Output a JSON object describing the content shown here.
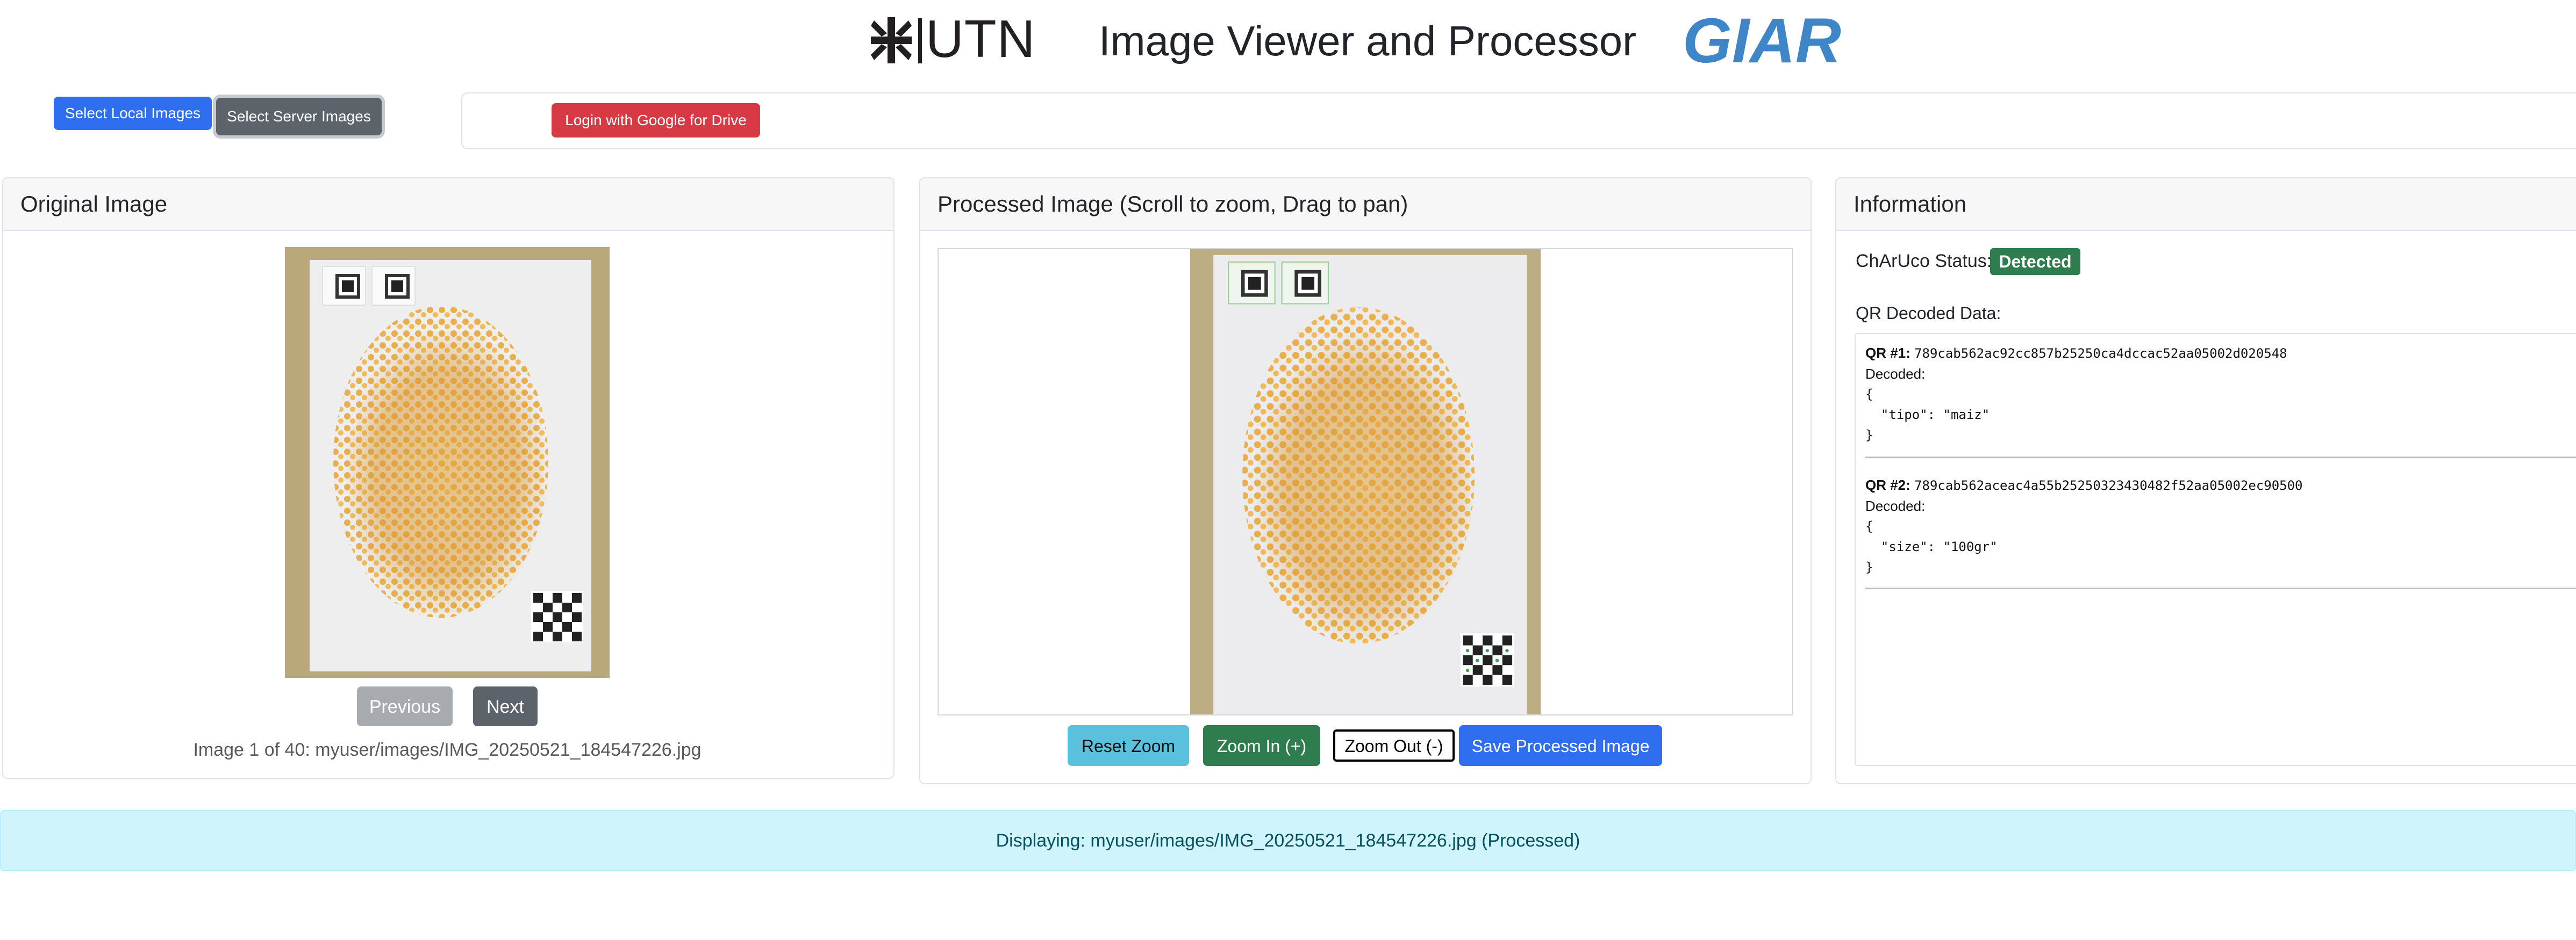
{
  "header": {
    "utn_logo_text": "UTN",
    "title": "Image Viewer and Processor",
    "giar_logo_text": "GIAR"
  },
  "toolbar": {
    "select_local_label": "Select Local Images",
    "select_server_label": "Select Server Images",
    "drive_login_label": "Login with Google for Drive"
  },
  "original_card": {
    "title": "Original Image",
    "previous_label": "Previous",
    "next_label": "Next",
    "counter_text": "Image 1 of 40: myuser/images/IMG_20250521_184547226.jpg"
  },
  "processed_card": {
    "title": "Processed Image (Scroll to zoom, Drag to pan)",
    "reset_zoom_label": "Reset Zoom",
    "zoom_in_label": "Zoom In (+)",
    "zoom_out_label": "Zoom Out (-)",
    "save_label": "Save Processed Image"
  },
  "info_card": {
    "title": "Information",
    "charuco_label": "ChArUco Status:",
    "charuco_status": "Detected",
    "qr_label": "QR Decoded Data:",
    "qr_entries": [
      {
        "label": "QR #1:",
        "hash": "789cab562ac92cc857b25250ca4dccac52aa05002d020548",
        "decoded_label": "Decoded:",
        "line1": "{",
        "line2": "  \"tipo\": \"maiz\"",
        "line3": "}"
      },
      {
        "label": "QR #2:",
        "hash": "789cab562aceac4a55b25250323430482f52aa05002ec90500",
        "decoded_label": "Decoded:",
        "line1": "{",
        "line2": "  \"size\": \"100gr\"",
        "line3": "}"
      }
    ]
  },
  "status_bar": {
    "text": "Displaying: myuser/images/IMG_20250521_184547226.jpg (Processed)"
  },
  "colors": {
    "primary": "#2f6fef",
    "secondary": "#5c636a",
    "danger": "#d83a45",
    "success": "#2f7d4f",
    "info": "#5bc0de",
    "alert_bg": "#cff4fc"
  }
}
